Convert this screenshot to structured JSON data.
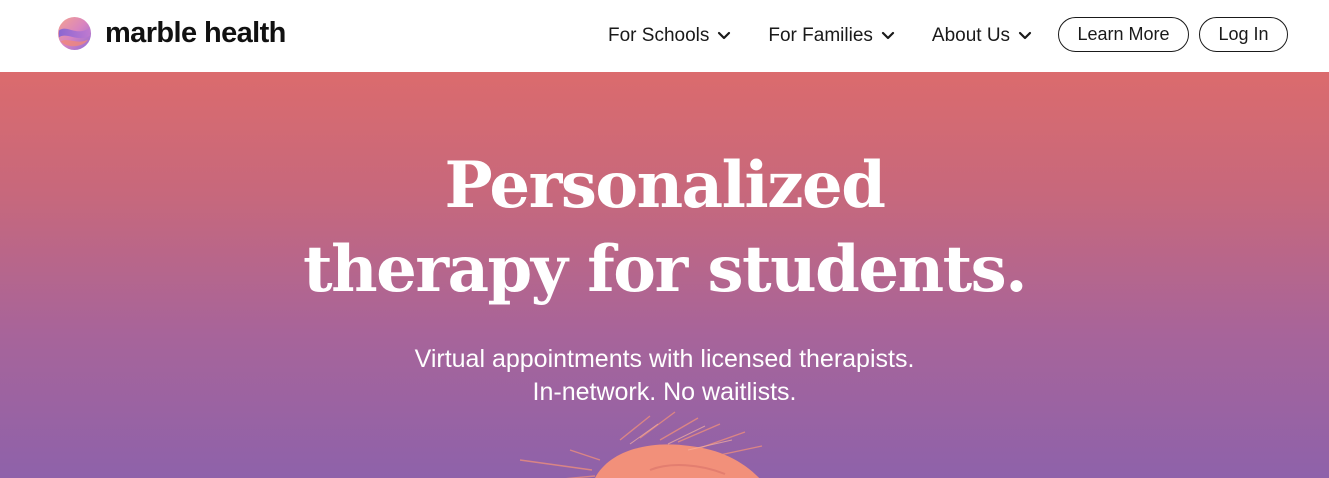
{
  "brand": {
    "name": "marble health"
  },
  "nav": {
    "items": [
      {
        "label": "For Schools",
        "icon": "chevron-down-icon"
      },
      {
        "label": "For Families",
        "icon": "chevron-down-icon"
      },
      {
        "label": "About Us",
        "icon": "chevron-down-icon"
      }
    ],
    "learn_more_label": "Learn More",
    "login_label": "Log In"
  },
  "hero": {
    "headline_line1": "Personalized",
    "headline_line2": "therapy for students.",
    "subtext_line1": "Virtual appointments with licensed therapists.",
    "subtext_line2": "In-network. No waitlists."
  },
  "colors": {
    "gradient_top": "#db6b6d",
    "gradient_bottom": "#8e62aa",
    "text_dark": "#1a1a1a",
    "splash": "#f2907a"
  }
}
